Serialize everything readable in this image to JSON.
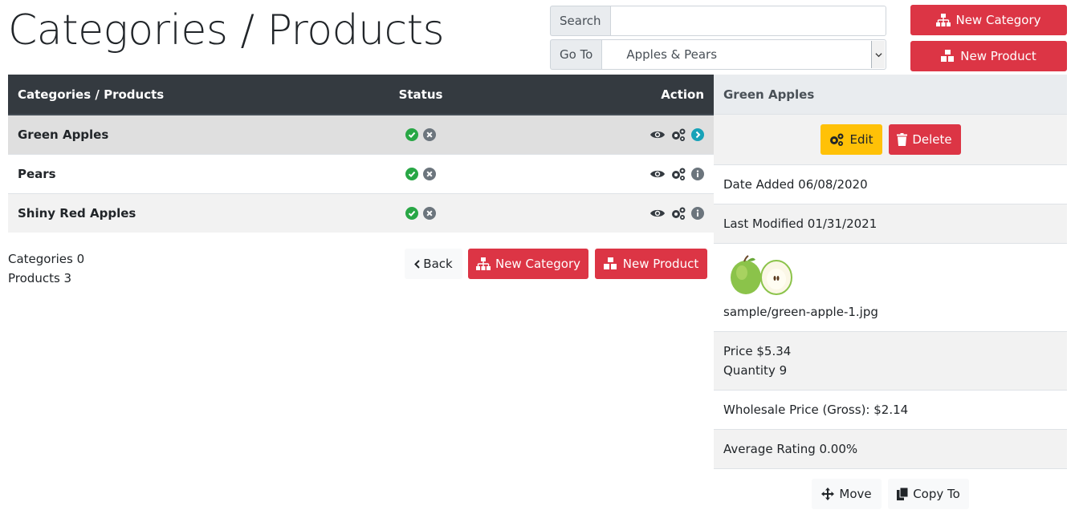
{
  "header": {
    "title": "Categories / Products"
  },
  "search": {
    "label": "Search",
    "value": ""
  },
  "goto": {
    "label": "Go To",
    "selected": "Apples & Pears"
  },
  "top_buttons": {
    "new_category": "New Category",
    "new_product": "New Product"
  },
  "table": {
    "columns": {
      "name": "Categories / Products",
      "status": "Status",
      "action": "Action"
    },
    "rows": [
      {
        "name": "Green Apples"
      },
      {
        "name": "Pears"
      },
      {
        "name": "Shiny Red Apples"
      }
    ]
  },
  "counts": {
    "categories": "Categories 0",
    "products": "Products 3"
  },
  "bottom_buttons": {
    "back": "Back",
    "new_category": "New Category",
    "new_product": "New Product"
  },
  "detail": {
    "title": "Green Apples",
    "edit": "Edit",
    "delete": "Delete",
    "date_added": "Date Added 06/08/2020",
    "last_modified": "Last Modified 01/31/2021",
    "image_path": "sample/green-apple-1.jpg",
    "price": "Price $5.34",
    "quantity": "Quantity 9",
    "wholesale": "Wholesale Price (Gross): $2.14",
    "rating": "Average Rating 0.00%",
    "move": "Move",
    "copy_to": "Copy To"
  },
  "colors": {
    "danger": "#dc3545",
    "warning": "#ffc107",
    "dark": "#343a40",
    "success": "#28a745",
    "secondary": "#6c757d",
    "info": "#17a2b8"
  }
}
